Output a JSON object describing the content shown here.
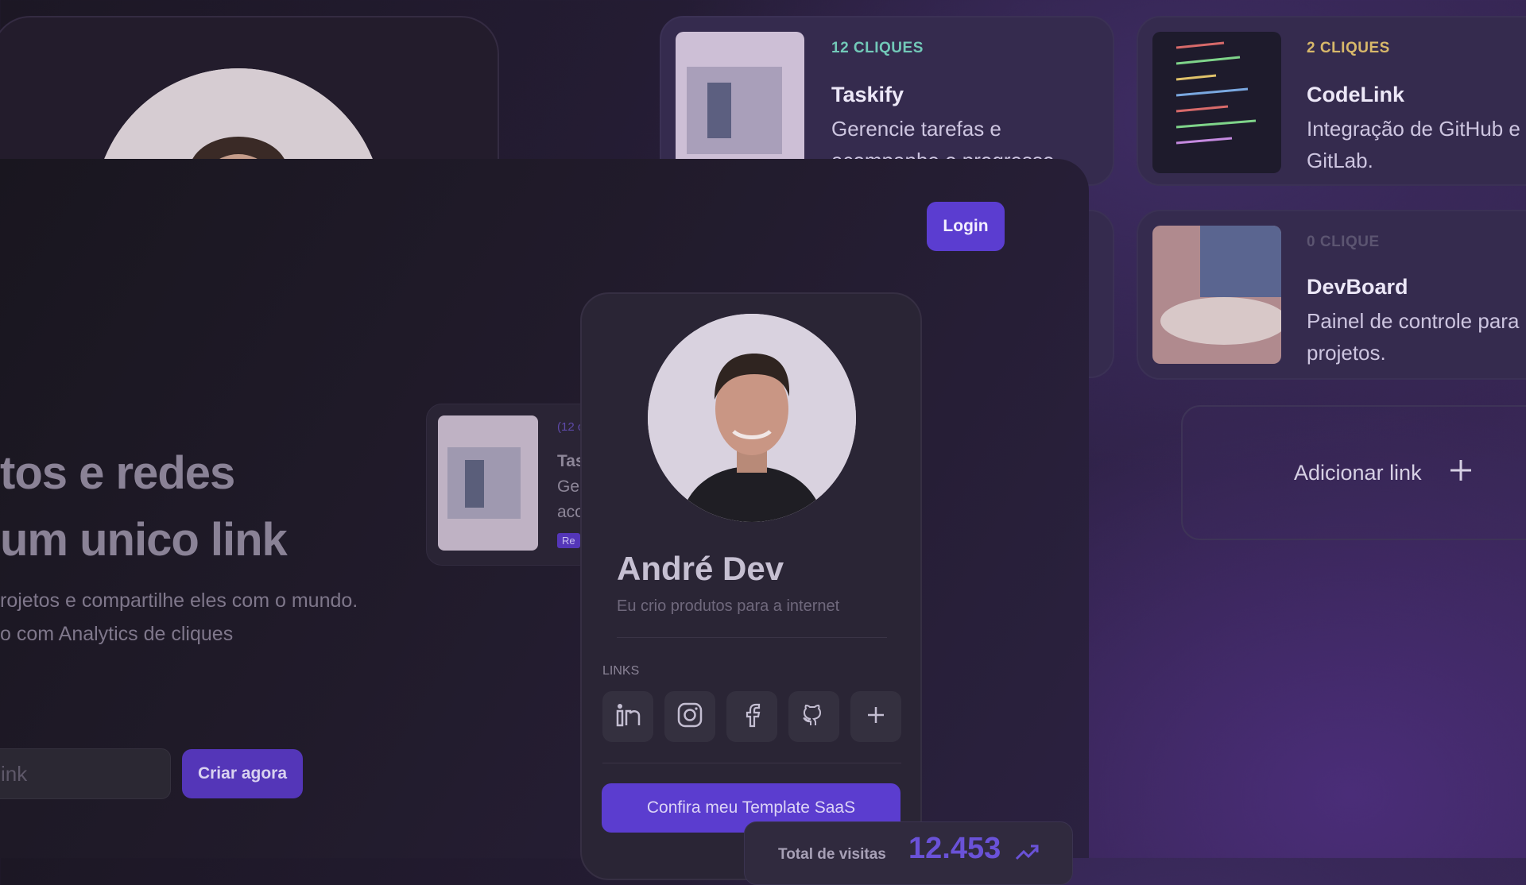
{
  "cards": [
    {
      "clicks": "12 CLIQUES",
      "title": "Taskify",
      "desc_line1": "Gerencie tarefas e",
      "desc_line2": "acompanhe o progresso."
    },
    {
      "clicks": "2 CLIQUES",
      "title": "CodeLink",
      "desc_line1": "Integração de GitHub e",
      "desc_line2": "GitLab."
    },
    {
      "clicks": "0 CLIQUE",
      "title": "DevBoard",
      "desc_line1": "Painel de controle para",
      "desc_line2": "projetos."
    }
  ],
  "add_link": {
    "label": "Adicionar link"
  },
  "header": {
    "login_label": "Login"
  },
  "hero": {
    "line1": "tos e redes",
    "line2": "um unico link",
    "sub1": "rojetos e compartilhe eles com o mundo.",
    "sub2": "o com Analytics de cliques"
  },
  "signup": {
    "input_value": "ink",
    "cta_label": "Criar agora"
  },
  "mini_card": {
    "clicks": "(12 c",
    "title": "Tas",
    "line1": "Ge",
    "line2": "acc",
    "badge": "Re"
  },
  "profile": {
    "name": "André Dev",
    "bio": "Eu crio produtos para a internet",
    "links_heading": "LINKS",
    "socials": [
      "linkedin-icon",
      "instagram-icon",
      "facebook-icon",
      "github-icon",
      "plus-icon"
    ],
    "template_button": "Confira meu Template SaaS"
  },
  "visits": {
    "label": "Total de visitas",
    "value": "12.453"
  },
  "colors": {
    "accent": "#5b3dcf",
    "clicks_teal": "#72c9b8",
    "clicks_gold": "#d8b86a",
    "clicks_dim": "#5c5571"
  }
}
